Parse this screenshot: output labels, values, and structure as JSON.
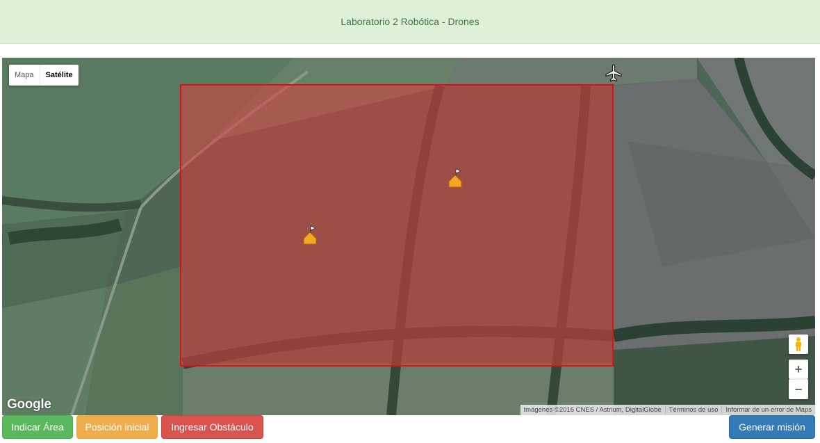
{
  "header": {
    "title": "Laboratorio 2 Robótica - Drones"
  },
  "map": {
    "type_control": {
      "map_label": "Mapa",
      "satellite_label": "Satélite",
      "selected": "Satélite"
    },
    "logo": "Google",
    "attribution": {
      "imagery": "Imágenes ©2016 CNES / Astrium, DigitalGlobe",
      "terms": "Términos de uso",
      "report": "Informar de un error de Maps"
    },
    "zoom": {
      "in_label": "+",
      "out_label": "−"
    },
    "overlay_color": "#e01010",
    "markers": [
      "flag-marker",
      "flag-marker"
    ],
    "drone_icon": "airplane-icon"
  },
  "buttons": {
    "indicate_area": "Indicar Área",
    "initial_position": "Posición inicial",
    "add_obstacle": "Ingresar Obstáculo",
    "generate_mission": "Generar misión"
  },
  "colors": {
    "success": "#5cb85c",
    "warning": "#f0ad4e",
    "danger": "#d9534f",
    "primary": "#337ab7",
    "header_bg": "#dff0d8"
  }
}
